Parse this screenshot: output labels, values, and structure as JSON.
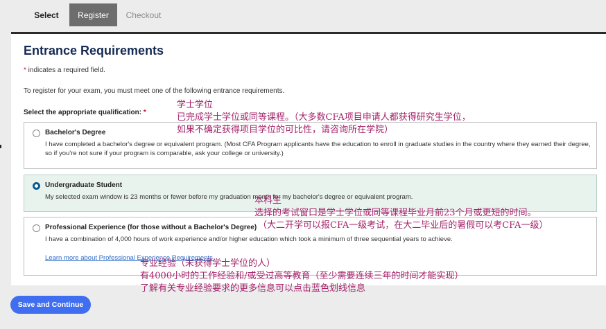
{
  "stepper": {
    "steps": [
      {
        "label": "Select"
      },
      {
        "label": "Register"
      },
      {
        "label": "Checkout"
      }
    ]
  },
  "form": {
    "title": "Entrance Requirements",
    "required_star": "*",
    "required_note": " indicates a required field.",
    "intro": "To register for your exam, you must meet one of the following entrance requirements.",
    "qualification_label": "Select the appropriate qualification: ",
    "options": [
      {
        "title": "Bachelor's Degree",
        "description": "I have completed a bachelor's degree or equivalent program. (Most CFA Program applicants have the education to enroll in graduate studies in the country where they earned their degree, so if you're not sure if your program is comparable, ask your college or university.)",
        "selected": false
      },
      {
        "title": "Undergraduate Student",
        "description": "My selected exam window is 23 months or fewer before my graduation month for my bachelor's degree or equivalent program.",
        "selected": true
      },
      {
        "title": "Professional Experience (for those without a Bachelor's Degree)",
        "description": "I have a combination of 4,000 hours of work experience and/or higher education which took a minimum of three sequential years to achieve.",
        "link": "Learn more about Professional Experience Requirements",
        "selected": false
      }
    ],
    "save_label": "Save and Continue"
  },
  "annotations": [
    "学士学位",
    "已完成学士学位或同等课程。（大多数CFA项目申请人都获得研究生学位，",
    "如果不确定获得项目学位的可比性，请咨询所在学院）",
    "本科生",
    "选择的考试窗口是学士学位或同等课程毕业月前23个月或更短的时间。",
    "（大二开学可以报CFA一级考试，在大二毕业后的暑假可以考CFA一级）",
    "专业经验（未获得学士学位的人）",
    "有4000小时的工作经验和/或受过高等教育（至少需要连续三年的时间才能实现）",
    "了解有关专业经验要求的更多信息可以点击蓝色划线信息"
  ],
  "colors": {
    "accent": "#3f6ef0",
    "title": "#142a52",
    "selected_bg": "#e9f3ee",
    "annotation": "#a4236a"
  }
}
